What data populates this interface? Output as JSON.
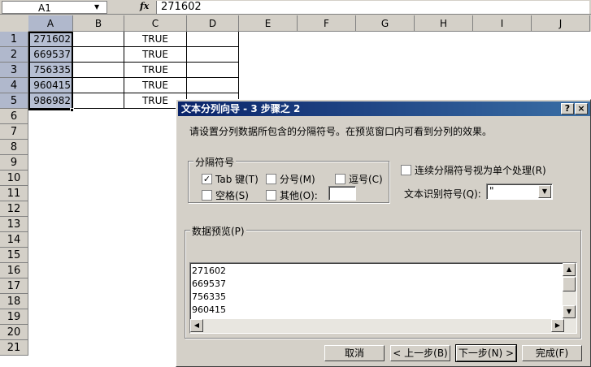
{
  "formula_bar": {
    "name_box": "A1",
    "fx_label": "fx",
    "formula": "271602"
  },
  "sheet": {
    "columns": [
      "A",
      "B",
      "C",
      "D",
      "E",
      "F",
      "G",
      "H",
      "I",
      "J"
    ],
    "rows": [
      "1",
      "2",
      "3",
      "4",
      "5",
      "6",
      "7",
      "8",
      "9",
      "10",
      "11",
      "12",
      "13",
      "14",
      "15",
      "16",
      "17",
      "18",
      "19",
      "20",
      "21"
    ],
    "data": [
      {
        "a": "271602",
        "c": "TRUE"
      },
      {
        "a": "669537",
        "c": "TRUE"
      },
      {
        "a": "756335",
        "c": "TRUE"
      },
      {
        "a": "960415",
        "c": "TRUE"
      },
      {
        "a": "986982",
        "c": "TRUE"
      }
    ]
  },
  "dialog": {
    "title": "文本分列向导 - 3 步骤之 2",
    "help_btn": "?",
    "close_btn": "×",
    "description": "请设置分列数据所包含的分隔符号。在预览窗口内可看到分列的效果。",
    "delimiters_group": "分隔符号",
    "tab": {
      "label": "Tab 键(T)",
      "checked": true
    },
    "semicolon": {
      "label": "分号(M)",
      "checked": false
    },
    "comma": {
      "label": "逗号(C)",
      "checked": false
    },
    "space": {
      "label": "空格(S)",
      "checked": false
    },
    "other": {
      "label": "其他(O):",
      "checked": false,
      "value": ""
    },
    "consecutive": {
      "label": "连续分隔符号视为单个处理(R)",
      "checked": false
    },
    "text_qualifier_label": "文本识别符号(Q):",
    "text_qualifier_value": "\"",
    "preview_group": "数据预览(P)",
    "preview_lines": [
      "271602",
      "669537",
      "756335",
      "960415"
    ],
    "buttons": {
      "cancel": "取消",
      "back": "< 上一步(B)",
      "next": "下一步(N) >",
      "finish": "完成(F)"
    }
  }
}
